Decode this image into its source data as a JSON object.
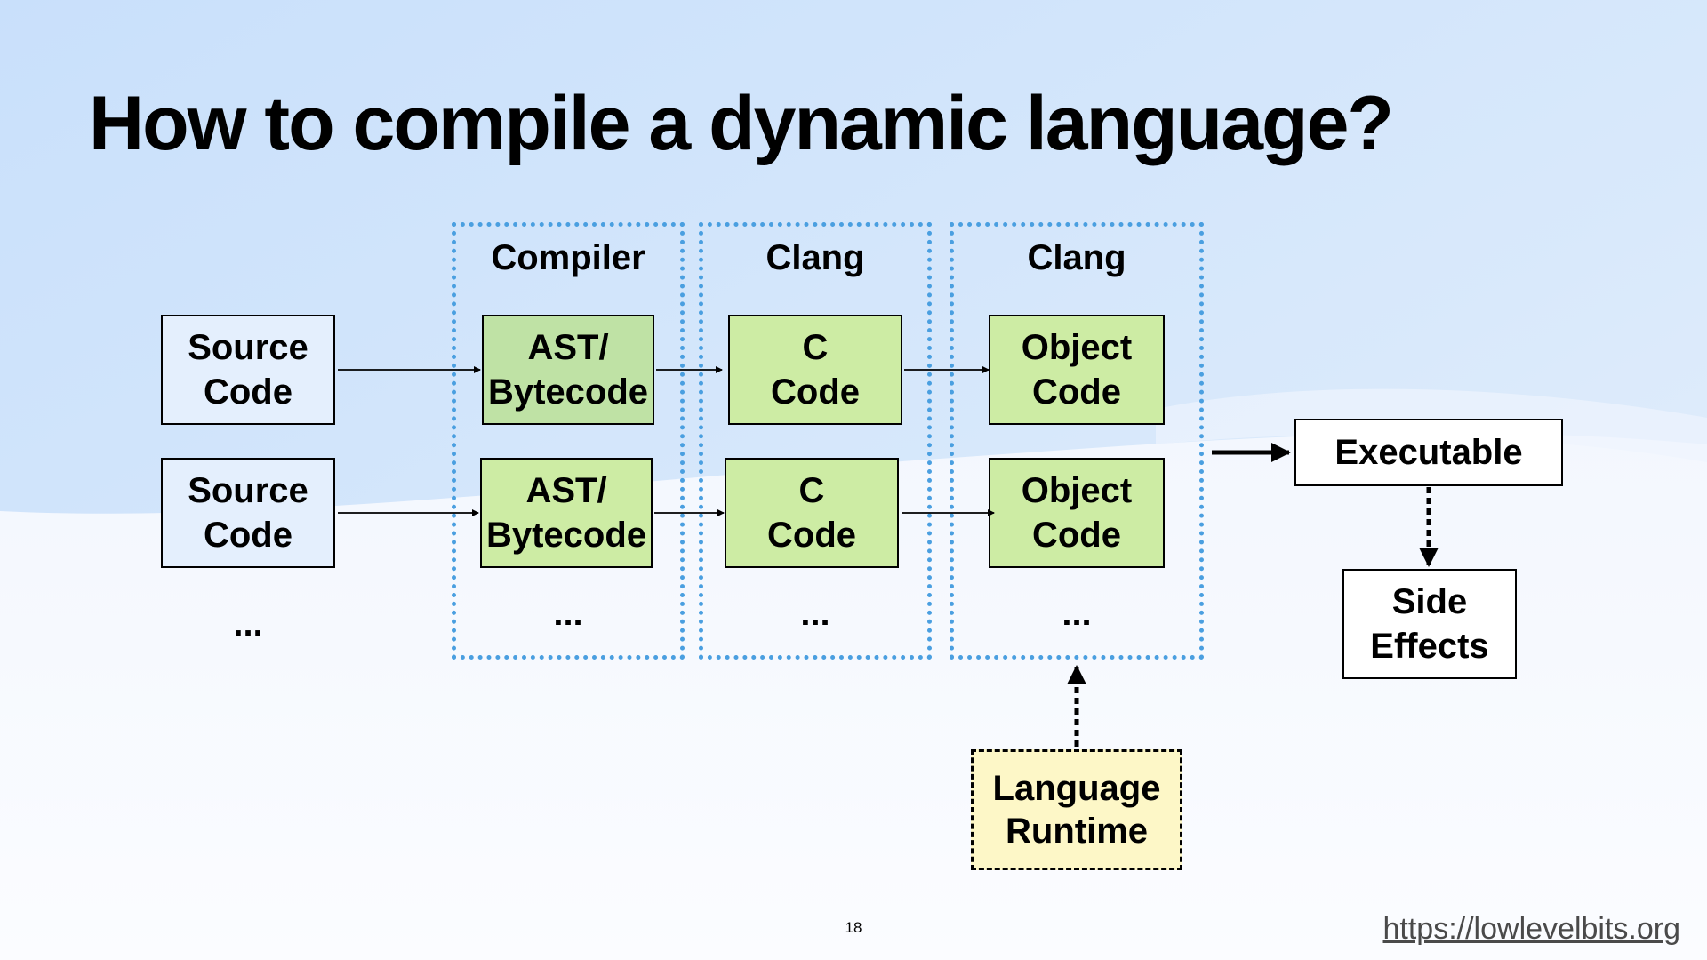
{
  "title": "How to compile a dynamic language?",
  "groups": {
    "compiler": "Compiler",
    "clang1": "Clang",
    "clang2": "Clang"
  },
  "boxes": {
    "source1": [
      "Source",
      "Code"
    ],
    "source2": [
      "Source",
      "Code"
    ],
    "ast1": [
      "AST/",
      "Bytecode"
    ],
    "ast2": [
      "AST/",
      "Bytecode"
    ],
    "c1": [
      "C",
      "Code"
    ],
    "c2": [
      "C",
      "Code"
    ],
    "obj1": [
      "Object",
      "Code"
    ],
    "obj2": [
      "Object",
      "Code"
    ],
    "executable": "Executable",
    "side_effects": [
      "Side",
      "Effects"
    ],
    "runtime": [
      "Language",
      "Runtime"
    ]
  },
  "ellipsis": "...",
  "page_number": "18",
  "footer_url": "https://lowlevelbits.org",
  "colors": {
    "group_border": "#4a9fe0",
    "source_fill": "#e4effd",
    "ast_fill": "#bfe2a5",
    "code_fill": "#cdeca4",
    "runtime_fill": "#fdf7c7"
  }
}
